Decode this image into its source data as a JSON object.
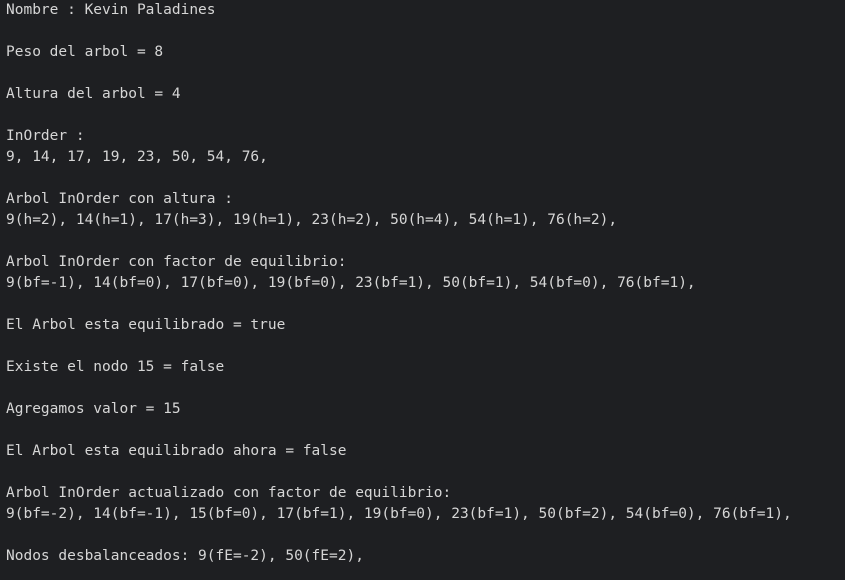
{
  "console": {
    "lines": [
      "Nombre : Kevin Paladines",
      "",
      "Peso del arbol = 8",
      "",
      "Altura del arbol = 4",
      "",
      "InOrder :",
      "9, 14, 17, 19, 23, 50, 54, 76,",
      "",
      "Arbol InOrder con altura :",
      "9(h=2), 14(h=1), 17(h=3), 19(h=1), 23(h=2), 50(h=4), 54(h=1), 76(h=2),",
      "",
      "Arbol InOrder con factor de equilibrio:",
      "9(bf=-1), 14(bf=0), 17(bf=0), 19(bf=0), 23(bf=1), 50(bf=1), 54(bf=0), 76(bf=1),",
      "",
      "El Arbol esta equilibrado = true",
      "",
      "Existe el nodo 15 = false",
      "",
      "Agregamos valor = 15",
      "",
      "El Arbol esta equilibrado ahora = false",
      "",
      "Arbol InOrder actualizado con factor de equilibrio:",
      "9(bf=-2), 14(bf=-1), 15(bf=0), 17(bf=1), 19(bf=0), 23(bf=1), 50(bf=2), 54(bf=0), 76(bf=1),",
      "",
      "Nodos desbalanceados: 9(fE=-2), 50(fE=2),"
    ]
  }
}
